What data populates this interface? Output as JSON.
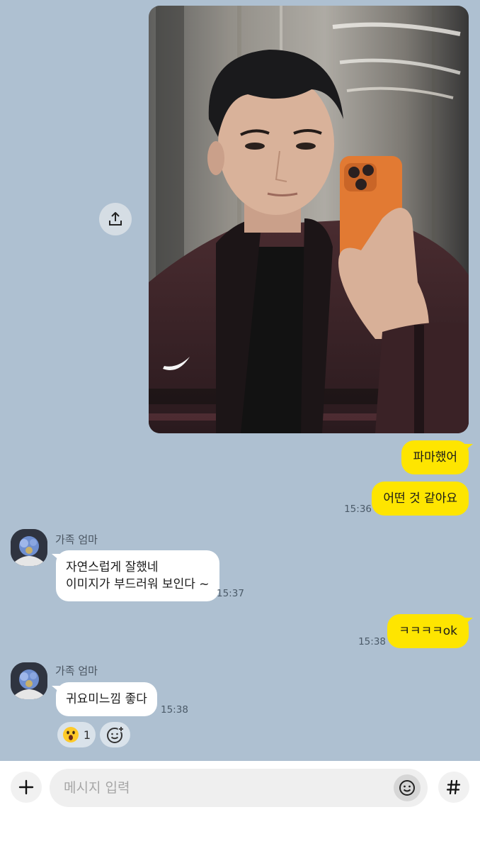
{
  "chat": {
    "messages": {
      "sent_1": "파마했어",
      "sent_2": "어떤 것 같아요",
      "sent_2_time": "15:36",
      "recv_1": "자연스럽게 잘했네\n이미지가 부드러워 보인다 ~",
      "recv_1_time": "15:37",
      "sent_3": "ㅋㅋㅋㅋok",
      "sent_3_time": "15:38",
      "recv_2": "귀요미느낌 좋다",
      "recv_2_time": "15:38"
    },
    "sender": {
      "name": "가족 엄마"
    },
    "reactions": [
      {
        "icon": "surprised-face-icon",
        "count": "1"
      }
    ]
  },
  "input": {
    "placeholder": "메시지 입력"
  },
  "colors": {
    "chat_background": "#aec0d1",
    "sent_bubble": "#fee500",
    "received_bubble": "#ffffff"
  }
}
